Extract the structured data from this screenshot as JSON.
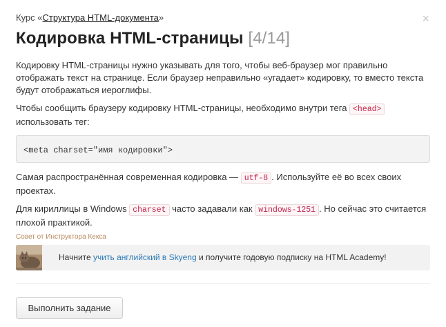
{
  "header": {
    "course_prefix": "Курс «",
    "course_link": "Структура HTML-документа",
    "course_suffix": "»",
    "close_glyph": "×",
    "title": "Кодировка HTML-страницы",
    "progress": "[4/14]"
  },
  "body": {
    "p1": "Кодировку HTML-страницы нужно указывать для того, чтобы веб-браузер мог правильно отображать текст на странице. Если браузер неправильно «угадает» кодировку, то вместо текста будут отображаться иероглифы.",
    "p2_before": "Чтобы сообщить браузеру кодировку HTML-страницы, необходимо внутри тега ",
    "p2_code": "<head>",
    "p2_after": " использовать тег:",
    "code_block": "<meta charset=\"имя кодировки\">",
    "p3_before": "Самая распространённая современная кодировка — ",
    "p3_code": "utf-8",
    "p3_after": ". Используйте её во всех своих проектах.",
    "p4_before": "Для кириллицы в Windows ",
    "p4_code1": "charset",
    "p4_middle": " часто задавали как ",
    "p4_code2": "windows-1251",
    "p4_after": ". Но сейчас это считается плохой практикой."
  },
  "tip": {
    "label": "Совет от Инструктора Кекса",
    "text_before": "Начните ",
    "link": "учить английский в Skyeng",
    "text_after": " и получите годовую подписку на HTML Academy!"
  },
  "actions": {
    "submit_label": "Выполнить задание"
  }
}
